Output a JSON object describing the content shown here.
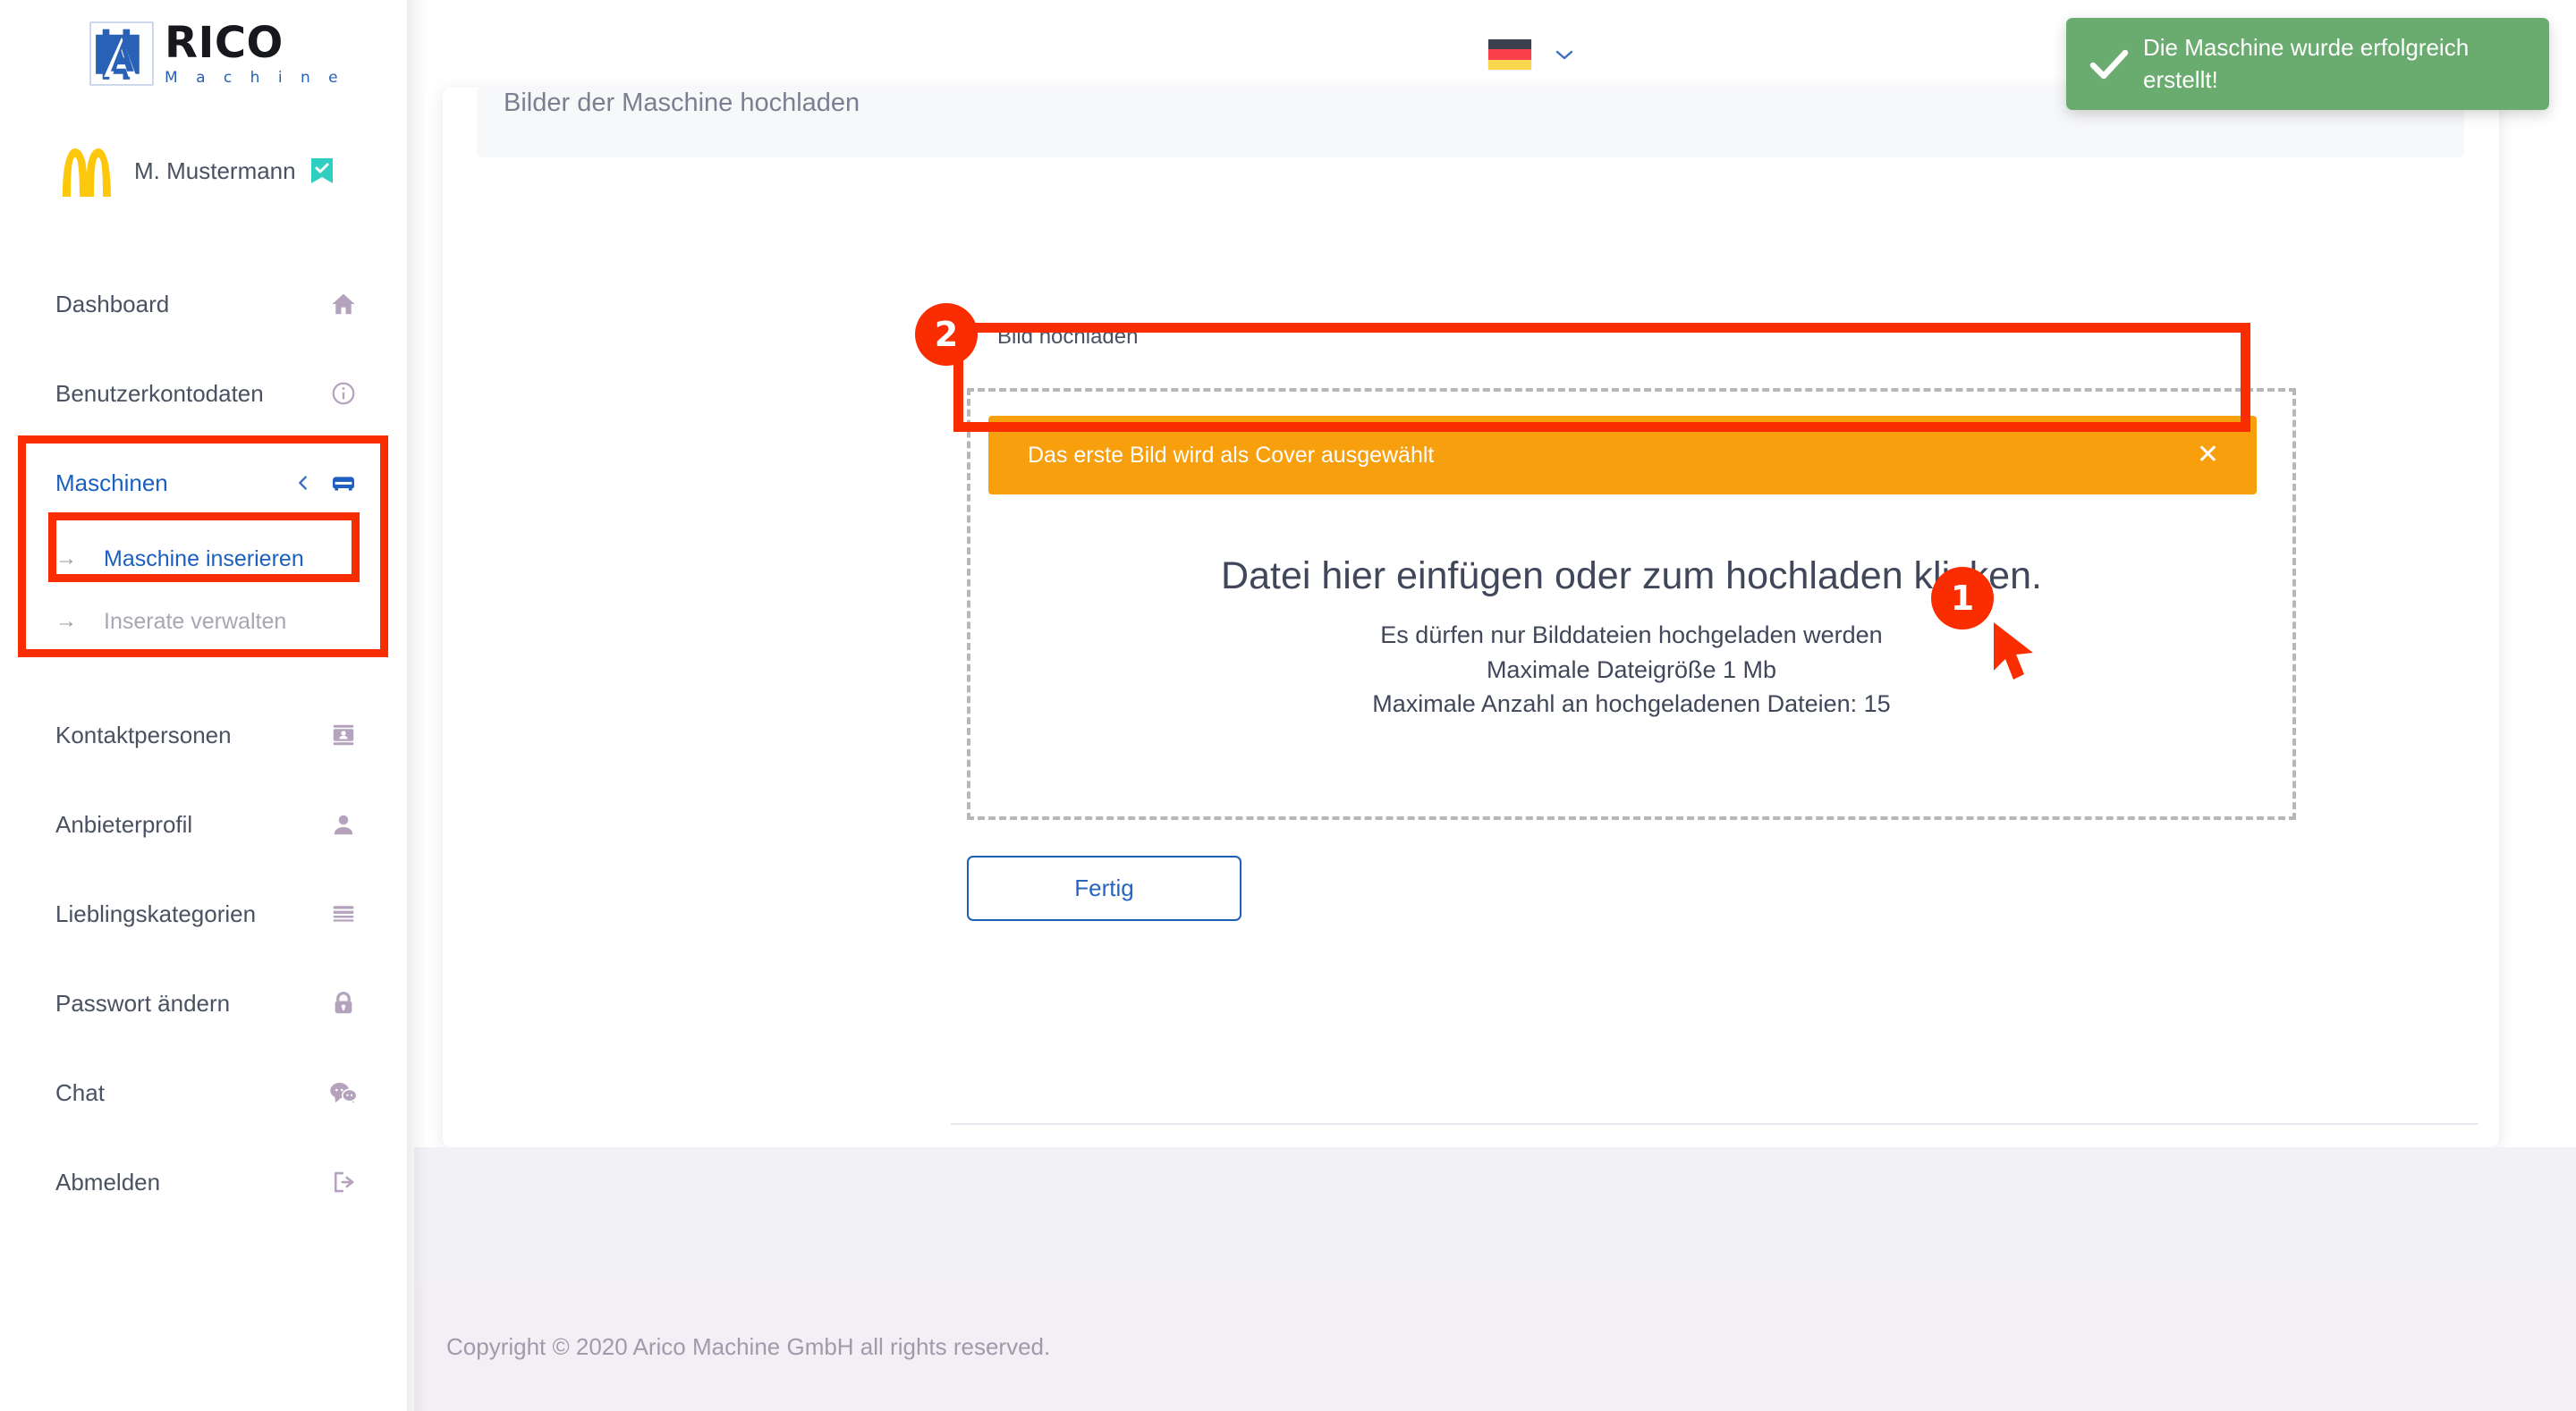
{
  "brand": {
    "name_primary": "RICO",
    "name_secondary": "M a c h i n e",
    "logo_icon": "gear-a-logo-icon",
    "color_blue": "#2861b5",
    "color_dark": "#16181d"
  },
  "user": {
    "name": "M. Mustermann",
    "avatar_icon": "golden-arches-avatar-icon",
    "verified_icon": "verified-bookmark-check-icon",
    "verified_color": "#2ecfc0"
  },
  "sidebar": {
    "items": [
      {
        "label": "Dashboard",
        "icon": "home-icon",
        "active": false
      },
      {
        "label": "Benutzerkontodaten",
        "icon": "info-circle-icon",
        "active": false
      },
      {
        "label": "Maschinen",
        "icon": "vehicle-icon",
        "active": true,
        "chevron": "chevron-left-icon",
        "submenu": [
          {
            "label": "Maschine inserieren",
            "icon": "arrow-right-icon",
            "active": true
          },
          {
            "label": "Inserate verwalten",
            "icon": "arrow-right-icon",
            "active": false
          }
        ]
      },
      {
        "label": "Kontaktpersonen",
        "icon": "contact-card-icon",
        "active": false
      },
      {
        "label": "Anbieterprofil",
        "icon": "person-icon",
        "active": false
      },
      {
        "label": "Lieblingskategorien",
        "icon": "list-lines-icon",
        "active": false
      },
      {
        "label": "Passwort ändern",
        "icon": "lock-icon",
        "active": false
      },
      {
        "label": "Chat",
        "icon": "chat-bubbles-icon",
        "active": false
      },
      {
        "label": "Abmelden",
        "icon": "logout-icon",
        "active": false
      }
    ]
  },
  "topbar": {
    "language": {
      "flag_icon": "german-flag-icon",
      "flag_colors": [
        "#3b414d",
        "#f9404a",
        "#fbd74f"
      ],
      "chevron_icon": "chevron-down-icon"
    }
  },
  "toast": {
    "message": "Die Maschine wurde erfolgreich erstellt!",
    "icon": "check-icon",
    "background": "#6aab6f"
  },
  "main": {
    "section_title": "Bilder der Maschine hochladen",
    "field_label": "Bild hochladen",
    "alert": {
      "text": "Das erste Bild wird als Cover ausgewählt",
      "close_icon": "close-x-icon",
      "background": "#f79f0d"
    },
    "dropzone": {
      "headline": "Datei hier einfügen oder zum hochladen klicken.",
      "line1": "Es dürfen nur Bilddateien hochgeladen werden",
      "line2": "Maximale Dateigröße 1 Mb",
      "line3": "Maximale Anzahl an hochgeladenen Dateien: 15"
    },
    "done_button": "Fertig"
  },
  "annotations": {
    "badge_1": "1",
    "badge_2": "2",
    "cursor_icon": "mouse-cursor-icon",
    "highlight_color": "#f92d00"
  },
  "footer": {
    "copyright": "Copyright © 2020  Arico Machine GmbH all rights reserved."
  }
}
